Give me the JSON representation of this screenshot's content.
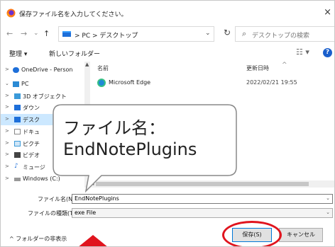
{
  "window": {
    "title": "保存ファイル名を入力してください。",
    "close": "×"
  },
  "nav": {
    "back": "←",
    "forward": "→",
    "history": "⌄",
    "up": "↑",
    "breadcrumb": "> PC > デスクトップ",
    "address_dropdown": "⌄",
    "refresh": "↻",
    "search_placeholder": "デスクトップの検索"
  },
  "toolbar": {
    "organize": "整理 ▾",
    "new_folder": "新しいフォルダー",
    "view": "☷ ▾",
    "help": "?"
  },
  "sidebar": {
    "items": [
      {
        "chevron": ">",
        "label": "OneDrive - Person",
        "icon": "cloud-icon",
        "color": "#1e6fd9"
      },
      {
        "chevron": "⌄",
        "label": "PC",
        "icon": "pc-icon",
        "color": "#2a8ad4"
      },
      {
        "chevron": ">",
        "label": "3D オブジェクト",
        "icon": "cube-icon",
        "color": "#3b9ad9"
      },
      {
        "chevron": ">",
        "label": "ダウン",
        "icon": "download-icon",
        "color": "#1e6fd9"
      },
      {
        "chevron": ">",
        "label": "デスク",
        "icon": "desktop-icon",
        "color": "#1e6fd9"
      },
      {
        "chevron": ">",
        "label": "ドキュ",
        "icon": "document-icon",
        "color": "#888888"
      },
      {
        "chevron": ">",
        "label": "ピクチ",
        "icon": "picture-icon",
        "color": "#3b9ad9"
      },
      {
        "chevron": ">",
        "label": "ビデオ",
        "icon": "video-icon",
        "color": "#444444"
      },
      {
        "chevron": ">",
        "label": "ミュージ",
        "icon": "music-icon",
        "color": "#1e6fd9"
      },
      {
        "chevron": ">",
        "label": "Windows (C:)",
        "icon": "drive-icon",
        "color": "#777777"
      }
    ]
  },
  "filelist": {
    "columns": {
      "name": "名前",
      "modified": "更新日時"
    },
    "rows": [
      {
        "name": "Microsoft Edge",
        "modified": "2022/02/21 19:55"
      }
    ]
  },
  "fields": {
    "filename_label": "ファイル名(N):",
    "filename_value": "EndNotePlugins",
    "filetype_label": "ファイルの種類(T):",
    "filetype_value": "exe File",
    "dropdown": "⌄"
  },
  "footer": {
    "hide_folders": "^ フォルダーの非表示",
    "save": "保存(S)",
    "cancel": "キャンセル"
  },
  "callout": {
    "line1": "ファイル名：",
    "line2": "EndNotePlugins"
  },
  "colors": {
    "accent": "#0078d7",
    "highlight": "#e0141e",
    "selection": "#cce8ff"
  }
}
